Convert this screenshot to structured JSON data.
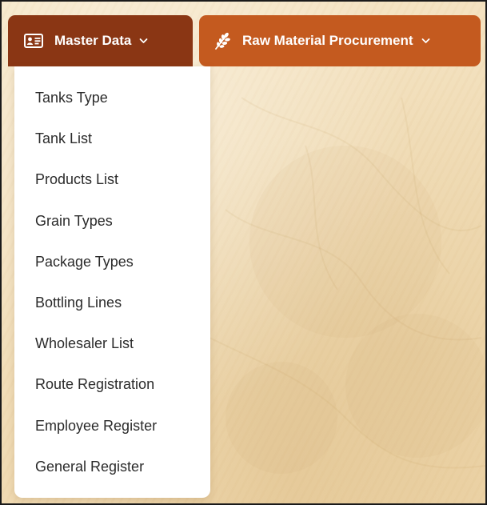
{
  "nav": {
    "master_data": {
      "label": "Master Data",
      "icon": "id-card-icon"
    },
    "raw_material": {
      "label": "Raw Material Procurement",
      "icon": "wheat-icon"
    }
  },
  "dropdown": {
    "items": [
      {
        "label": "Tanks Type"
      },
      {
        "label": "Tank List"
      },
      {
        "label": "Products List"
      },
      {
        "label": "Grain Types"
      },
      {
        "label": "Package Types"
      },
      {
        "label": "Bottling Lines"
      },
      {
        "label": "Wholesaler List"
      },
      {
        "label": "Route Registration"
      },
      {
        "label": "Employee Register"
      },
      {
        "label": "General Register"
      }
    ]
  },
  "colors": {
    "master_bg": "#8a3614",
    "raw_bg": "#c45a1f",
    "page_bg": "#f2dfbb"
  }
}
